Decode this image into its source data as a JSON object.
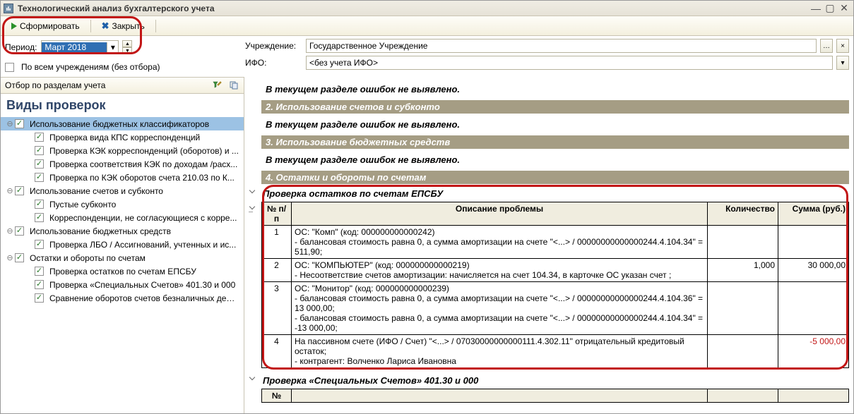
{
  "window": {
    "title": "Технологический анализ бухгалтерского учета"
  },
  "toolbar": {
    "form": "Сформировать",
    "close": "Закрыть"
  },
  "filters": {
    "period_label": "Период:",
    "period_value": "Март 2018",
    "all_orgs_label": "По всем учреждениям (без отбора)",
    "org_label": "Учреждение:",
    "org_value": "Государственное Учреждение",
    "ifo_label": "ИФО:",
    "ifo_value": "<без учета ИФО>"
  },
  "left": {
    "section_title": "Отбор по разделам учета",
    "heading": "Виды проверок",
    "tree": [
      {
        "level": 0,
        "expand": "-",
        "checked": true,
        "label": "Использование бюджетных классификаторов",
        "selected": true
      },
      {
        "level": 1,
        "checked": true,
        "label": "Проверка вида КПС корреспонденций"
      },
      {
        "level": 1,
        "checked": true,
        "label": "Проверка КЭК корреспонденций (оборотов) и ..."
      },
      {
        "level": 1,
        "checked": true,
        "label": "Проверка соответствия КЭК по доходам /расх..."
      },
      {
        "level": 1,
        "checked": true,
        "label": "Проверка по КЭК оборотов счета 210.03 по К..."
      },
      {
        "level": 0,
        "expand": "-",
        "checked": true,
        "label": "Использование счетов и субконто"
      },
      {
        "level": 1,
        "checked": true,
        "label": "Пустые субконто"
      },
      {
        "level": 1,
        "checked": true,
        "label": "Корреспонденции, не согласующиеся с корре..."
      },
      {
        "level": 0,
        "expand": "-",
        "checked": true,
        "label": "Использование бюджетных средств"
      },
      {
        "level": 1,
        "checked": true,
        "label": "Проверка ЛБО / Ассигнований, учтенных и ис..."
      },
      {
        "level": 0,
        "expand": "-",
        "checked": true,
        "label": "Остатки и обороты по счетам"
      },
      {
        "level": 1,
        "checked": true,
        "label": "Проверка остатков по счетам ЕПСБУ"
      },
      {
        "level": 1,
        "checked": true,
        "label": "Проверка «Специальных Счетов» 401.30 и 000"
      },
      {
        "level": 1,
        "checked": true,
        "label": "Сравнение оборотов счетов безналичных дене..."
      }
    ]
  },
  "report": {
    "noerr": "В текущем разделе ошибок не выявлено.",
    "sections": {
      "s2": "2. Использование счетов и субконто",
      "s3": "3. Использование бюджетных средств",
      "s4": "4. Остатки и обороты по счетам"
    },
    "table1": {
      "title": "Проверка остатков по счетам ЕПСБУ",
      "headers": {
        "n": "№ п/п",
        "desc": "Описание проблемы",
        "qty": "Количество",
        "sum": "Сумма (руб.)"
      },
      "rows": [
        {
          "n": "1",
          "desc": "ОС: \"Комп\" (код: 000000000000242)\n - балансовая стоимость равна 0, а сумма амортизации на счете \"<...> / 00000000000000244.4.104.34\" = 511,90;",
          "qty": "",
          "sum": ""
        },
        {
          "n": "2",
          "desc": "ОС: \"КОМПЬЮТЕР\" (код: 000000000000219)\n - Несоответствие счетов амортизации: начисляется на счет 104.34, в карточке ОС указан счет ;",
          "qty": "1,000",
          "sum": "30 000,00"
        },
        {
          "n": "3",
          "desc": "ОС: \"Монитор\" (код: 000000000000239)\n - балансовая стоимость равна 0, а сумма амортизации на счете \"<...> / 00000000000000244.4.104.36\" = 13 000,00;\n - балансовая стоимость равна 0, а сумма амортизации на счете \"<...> / 00000000000000244.4.104.34\" = -13 000,00;",
          "qty": "",
          "sum": ""
        },
        {
          "n": "4",
          "desc": "На пассивном счете (ИФО / Счет) \"<...> / 07030000000000111.4.302.11\" отрицательный кредитовый остаток;\n - контрагент: Волченко Лариса Ивановна",
          "qty": "",
          "sum": "-5 000,00",
          "neg": true
        }
      ]
    },
    "table2": {
      "title": "Проверка «Специальных Счетов» 401.30 и 000",
      "header_n": "№"
    }
  }
}
